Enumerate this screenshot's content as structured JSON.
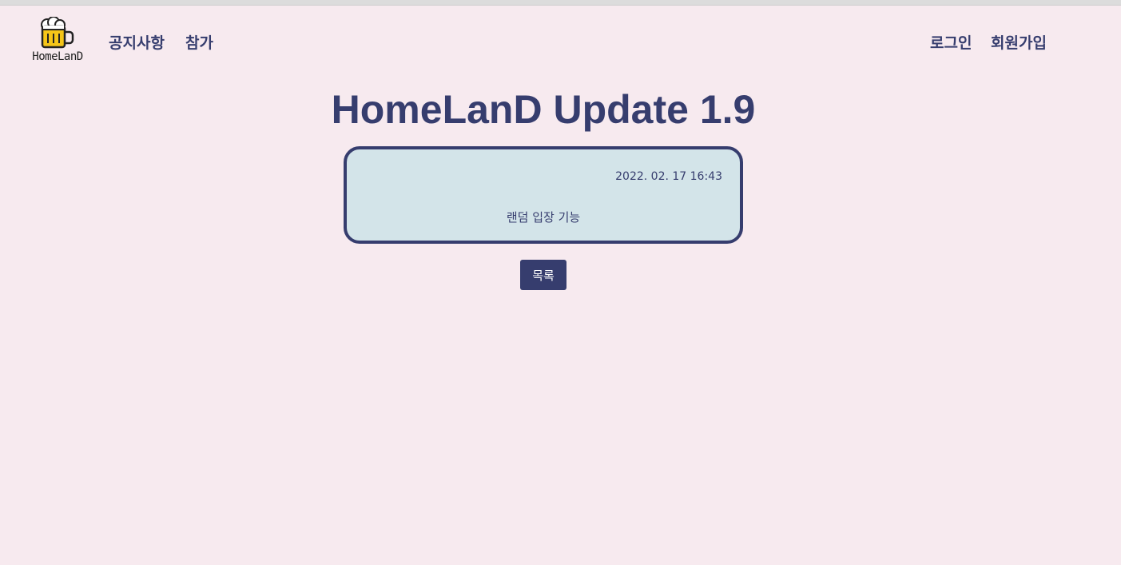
{
  "header": {
    "logo_text": "HomeLanD",
    "nav_left": [
      {
        "label": "공지사항"
      },
      {
        "label": "참가"
      }
    ],
    "nav_right": [
      {
        "label": "로그인"
      },
      {
        "label": "회원가입"
      }
    ]
  },
  "post": {
    "title": "HomeLanD Update 1.9",
    "date": "2022. 02. 17 16:43",
    "body": "랜덤 입장 기능"
  },
  "actions": {
    "list_label": "목록"
  },
  "colors": {
    "background": "#f7eaef",
    "primary": "#363d6e",
    "card_background": "#d3e4e9",
    "beer_yellow": "#f5c518"
  },
  "icons": {
    "logo": "beer-mug-icon"
  }
}
